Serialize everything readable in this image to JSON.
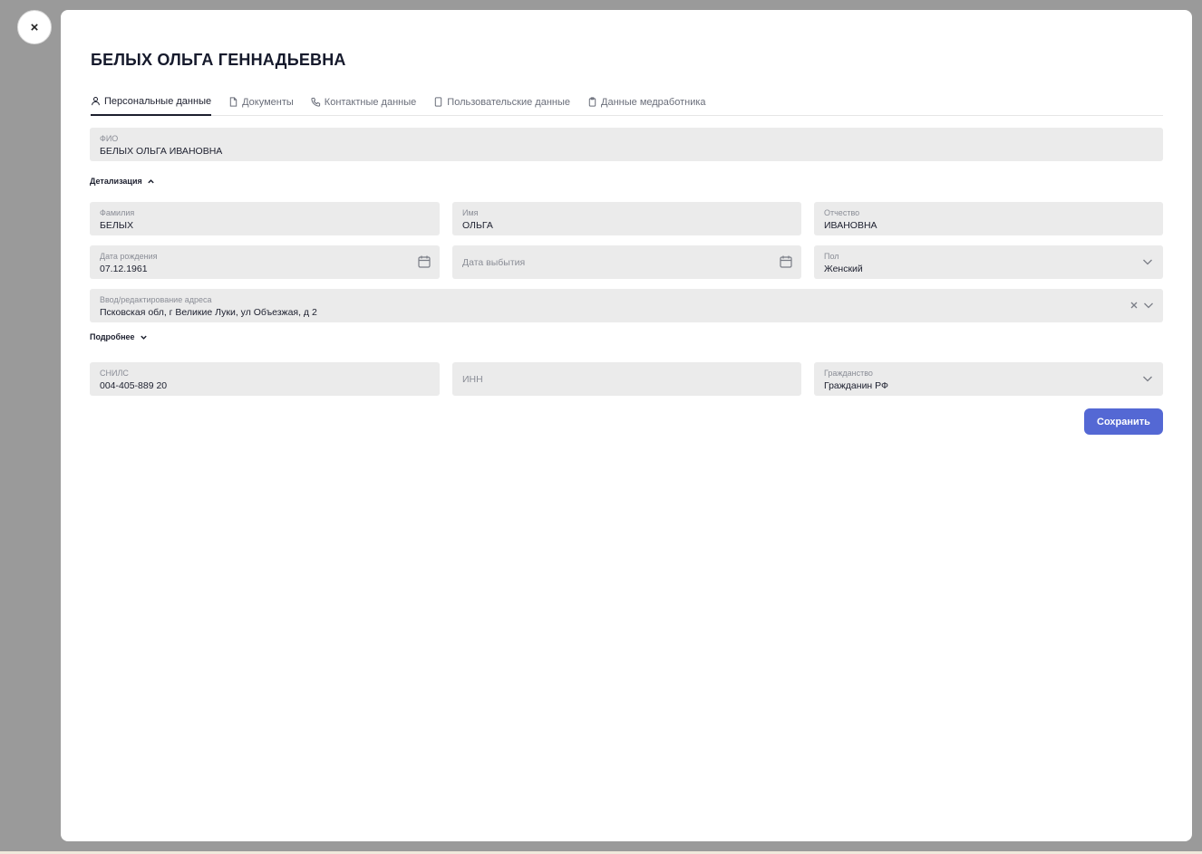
{
  "close_label": "×",
  "title": "БЕЛЫХ ОЛЬГА ГЕННАДЬЕВНА",
  "tabs": [
    {
      "label": "Персональные данные",
      "icon": "user-icon"
    },
    {
      "label": "Документы",
      "icon": "document-icon"
    },
    {
      "label": "Контактные данные",
      "icon": "phone-icon"
    },
    {
      "label": "Пользовательские данные",
      "icon": "device-icon"
    },
    {
      "label": "Данные медработника",
      "icon": "clipboard-icon"
    }
  ],
  "fio": {
    "label": "ФИО",
    "value": "БЕЛЫХ ОЛЬГА ИВАНОВНА"
  },
  "detail_toggle": "Детализация",
  "last_name": {
    "label": "Фамилия",
    "value": "БЕЛЫХ"
  },
  "first_name": {
    "label": "Имя",
    "value": "ОЛЬГА"
  },
  "patronymic": {
    "label": "Отчество",
    "value": "ИВАНОВНА"
  },
  "birth_date": {
    "label": "Дата рождения",
    "value": "07.12.1961"
  },
  "departure_date": {
    "placeholder": "Дата выбытия"
  },
  "gender": {
    "label": "Пол",
    "value": "Женский"
  },
  "address": {
    "label": "Ввод/редактирование адреса",
    "value": "Псковская обл, г Великие Луки, ул Объезжая, д 2"
  },
  "more_toggle": "Подробнее",
  "snils": {
    "label": "СНИЛС",
    "value": "004-405-889 20"
  },
  "inn": {
    "placeholder": "ИНН"
  },
  "citizenship": {
    "label": "Гражданство",
    "value": "Гражданин РФ"
  },
  "save_label": "Сохранить",
  "colors": {
    "accent": "#5468d4",
    "field_bg": "#ebebeb",
    "overlay": "#9a9a9a"
  }
}
